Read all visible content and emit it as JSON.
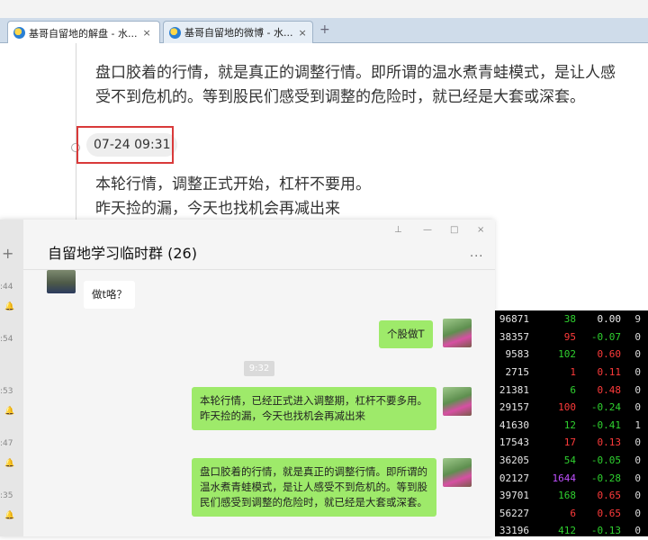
{
  "browser": {
    "tabs": [
      {
        "title": "基哥自留地的解盘 - 水...",
        "close": "×"
      },
      {
        "title": "基哥自留地的微博 - 水...",
        "close": "×"
      }
    ],
    "new_tab": "+"
  },
  "blog": {
    "para1_line1": "盘口胶着的行情，就是真正的调整行情。即所谓的温水煮青蛙模式，是让人感",
    "para1_line2": "受不到危机的。等到股民们感受到调整的危险时，就已经是大套或深套。",
    "post_time": "07-24 09:31",
    "para2_line1": "本轮行情，调整正式开始，杠杆不要用。",
    "para2_line2": "昨天捡的漏，今天也找机会再减出来"
  },
  "chat": {
    "title": "自留地学习临时群 (26)",
    "more": "...",
    "controls": {
      "pin": "⊥",
      "minimize": "—",
      "maximize": "□",
      "close": "×"
    },
    "sidebar": {
      "add": "+",
      "times": [
        ":44",
        ":54",
        ":53",
        ":47",
        ":35"
      ]
    },
    "messages": [
      {
        "side": "in",
        "text": "做t咯？"
      },
      {
        "side": "out",
        "text": "个股做T"
      },
      {
        "side": "out",
        "text": "本轮行情，已经正式进入调整期，杠杆不要多用。\n昨天捡的漏，今天也找机会再减出来"
      },
      {
        "side": "out",
        "text": "盘口胶着的行情，就是真正的调整行情。即所谓的温水煮青蛙模式，是让人感受不到危机的。等到股民们感受到调整的危险时，就已经是大套或深套。"
      }
    ],
    "timestamp": "9:32"
  },
  "stock_rows": [
    [
      "96871",
      "38",
      "0.00",
      "9"
    ],
    [
      "38357",
      "95",
      "-0.07",
      "0"
    ],
    [
      "9583",
      "102",
      "0.60",
      "0"
    ],
    [
      "2715",
      "1",
      "0.11",
      "0"
    ],
    [
      "21381",
      "6",
      "0.48",
      "0"
    ],
    [
      "29157",
      "100",
      "-0.24",
      "0"
    ],
    [
      "41630",
      "12",
      "-0.41",
      "1"
    ],
    [
      "17543",
      "17",
      "0.13",
      "0"
    ],
    [
      "36205",
      "54",
      "-0.05",
      "0"
    ],
    [
      "02127",
      "1644",
      "-0.28",
      "0"
    ],
    [
      "39701",
      "168",
      "0.65",
      "0"
    ],
    [
      "56227",
      "6",
      "0.65",
      "0"
    ],
    [
      "33196",
      "412",
      "-0.13",
      "0"
    ]
  ],
  "colors": {
    "accent_red": "#d93a3a",
    "bubble_green": "#9eea6a"
  }
}
